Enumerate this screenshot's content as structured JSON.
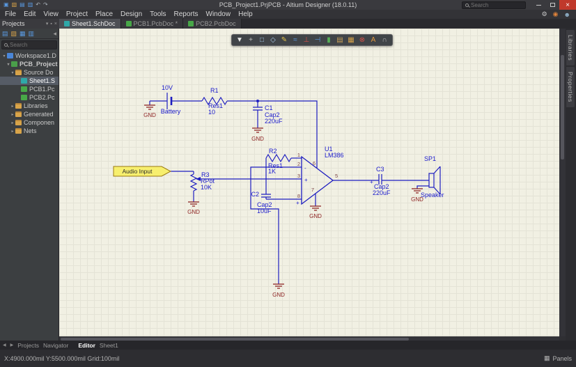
{
  "window": {
    "title": "PCB_Project1.PrjPCB - Altium Designer (18.0.11)",
    "search": "Search",
    "close": "×"
  },
  "titlebar_icons": [
    {
      "name": "new-document-icon",
      "glyph": "▣",
      "color": "#5a9ae2"
    },
    {
      "name": "open-folder-icon",
      "glyph": "▧",
      "color": "#d8a44a"
    },
    {
      "name": "save-icon",
      "glyph": "▤",
      "color": "#5a9ae2"
    },
    {
      "name": "print-icon",
      "glyph": "▥",
      "color": "#5a9ae2"
    },
    {
      "name": "undo-icon",
      "glyph": "↶",
      "color": "#a8b0b8"
    },
    {
      "name": "redo-icon",
      "glyph": "↷",
      "color": "#a8b0b8"
    }
  ],
  "menu": {
    "items": [
      "File",
      "Edit",
      "View",
      "Project",
      "Place",
      "Design",
      "Tools",
      "Reports",
      "Window",
      "Help"
    ]
  },
  "menu_icons": [
    {
      "name": "gear-icon",
      "glyph": "⚙",
      "color": "#c8c8c8"
    },
    {
      "name": "notification-icon",
      "glyph": "◉",
      "color": "#e0833a"
    },
    {
      "name": "user-icon",
      "glyph": "☻",
      "color": "#8fb0c8"
    }
  ],
  "doc_tabs": [
    {
      "label": "Sheet1.SchDoc",
      "kind": "sch"
    },
    {
      "label": "PCB1.PcbDoc *",
      "kind": "pcb"
    },
    {
      "label": "PCB2.PcbDoc",
      "kind": "pcb"
    }
  ],
  "projects": {
    "title": "Projects",
    "search": "Search",
    "header_icons": [
      {
        "name": "dropdown-icon",
        "glyph": "▾"
      },
      {
        "name": "pin-icon",
        "glyph": "▪"
      },
      {
        "name": "close-icon",
        "glyph": "×"
      }
    ],
    "panel_icons": [
      {
        "name": "save-all-icon",
        "glyph": "▤",
        "color": "#5a9ae2"
      },
      {
        "name": "open-project-icon",
        "glyph": "▧",
        "color": "#d8a44a"
      },
      {
        "name": "compile-icon",
        "glyph": "▦",
        "color": "#5a9ae2"
      },
      {
        "name": "panel-settings-icon",
        "glyph": "▥",
        "color": "#5a9ae2"
      },
      {
        "name": "scroll-left-icon",
        "glyph": "◂",
        "color": "#9a9a9a"
      }
    ],
    "tree": [
      {
        "label": "Workspace1.D",
        "arrow": "▾",
        "kind": "workspace"
      },
      {
        "label": "PCB_Project",
        "arrow": "▾",
        "kind": "project"
      },
      {
        "label": "Source Do",
        "arrow": "▾",
        "kind": "folder"
      },
      {
        "label": "Sheet1.S",
        "arrow": "",
        "kind": "sch"
      },
      {
        "label": "PCB1.Pc",
        "arrow": "",
        "kind": "pcb"
      },
      {
        "label": "PCB2.Pc",
        "arrow": "",
        "kind": "pcb"
      },
      {
        "label": "Libraries",
        "arrow": "▸",
        "kind": "folder"
      },
      {
        "label": "Generated",
        "arrow": "▸",
        "kind": "folder"
      },
      {
        "label": "Componen",
        "arrow": "▸",
        "kind": "folder"
      },
      {
        "label": "Nets",
        "arrow": "▸",
        "kind": "folder"
      }
    ]
  },
  "toolbar": {
    "icons": [
      {
        "name": "filter-tool-icon",
        "glyph": "▼",
        "color": "#e8e8e8"
      },
      {
        "name": "move-tool-icon",
        "glyph": "+",
        "color": "#c0c0c0"
      },
      {
        "name": "select-rect-icon",
        "glyph": "□",
        "color": "#a8c8e8"
      },
      {
        "name": "select-lasso-icon",
        "glyph": "◇",
        "color": "#a8c8e8"
      },
      {
        "name": "place-pencil-icon",
        "glyph": "✎",
        "color": "#e2c24a"
      },
      {
        "name": "place-wire-icon",
        "glyph": "≈",
        "color": "#5a9ae2"
      },
      {
        "name": "place-probe-icon",
        "glyph": "⊥",
        "color": "#d45248"
      },
      {
        "name": "place-bus-icon",
        "glyph": "⊣",
        "color": "#5a9ae2"
      },
      {
        "name": "place-part-icon",
        "glyph": "▮",
        "color": "#56ae56"
      },
      {
        "name": "place-sheet-icon",
        "glyph": "▤",
        "color": "#c8a058"
      },
      {
        "name": "place-sheet-entry-icon",
        "glyph": "▦",
        "color": "#d8a44a"
      },
      {
        "name": "place-noerc-icon",
        "glyph": "⊗",
        "color": "#d45248"
      },
      {
        "name": "place-text-icon",
        "glyph": "A",
        "color": "#e2983e"
      },
      {
        "name": "place-arc-icon",
        "glyph": "∩",
        "color": "#b8b8b8"
      }
    ]
  },
  "schematic": {
    "labels": {
      "v_bat": "10V",
      "bat": "Battery",
      "gnd": "GND",
      "r1": "R1",
      "r1_t": "Res1",
      "r1_v": "10",
      "c1": "C1",
      "c1_t": "Cap2",
      "c1_v": "220uF",
      "r2": "R2",
      "r2_t": "Res1",
      "r2_v": "1K",
      "u1": "U1",
      "u1_t": "LM386",
      "port": "Audio Input",
      "r3": "R3",
      "r3_t": "RPot",
      "r3_v": "10K",
      "c2": "C2",
      "c2_t": "Cap2",
      "c2_v": "10uF",
      "c3": "C3",
      "c3_t": "Cap2",
      "c3_v": "220uF",
      "sp": "SP1",
      "sp_t": "Speaker",
      "p1": "1",
      "p2": "2",
      "p3": "3",
      "p5": "5",
      "p6": "6",
      "p7": "7",
      "p8": "8",
      "plus": "+",
      "minus": "-"
    },
    "colors": {
      "wire": "#1d1dc0",
      "label": "#1a1acc",
      "gnd": "#8b1f1f",
      "pin": "#7d4848",
      "port_fill": "#f7ef6e",
      "port_border": "#9a7a10"
    }
  },
  "right_tabs": {
    "items": [
      "Libraries",
      "Properties"
    ]
  },
  "bottom": {
    "nav_left": "◀",
    "nav_right": "▶",
    "panel_tabs": [
      "Projects",
      "Navigator"
    ],
    "editor_tab": "Editor",
    "sheet_tab": "Sheet1"
  },
  "status": {
    "coords": "X:4900.000mil Y:5500.000mil Grid:100mil",
    "panels": "Panels",
    "panels_glyph": "▦"
  }
}
